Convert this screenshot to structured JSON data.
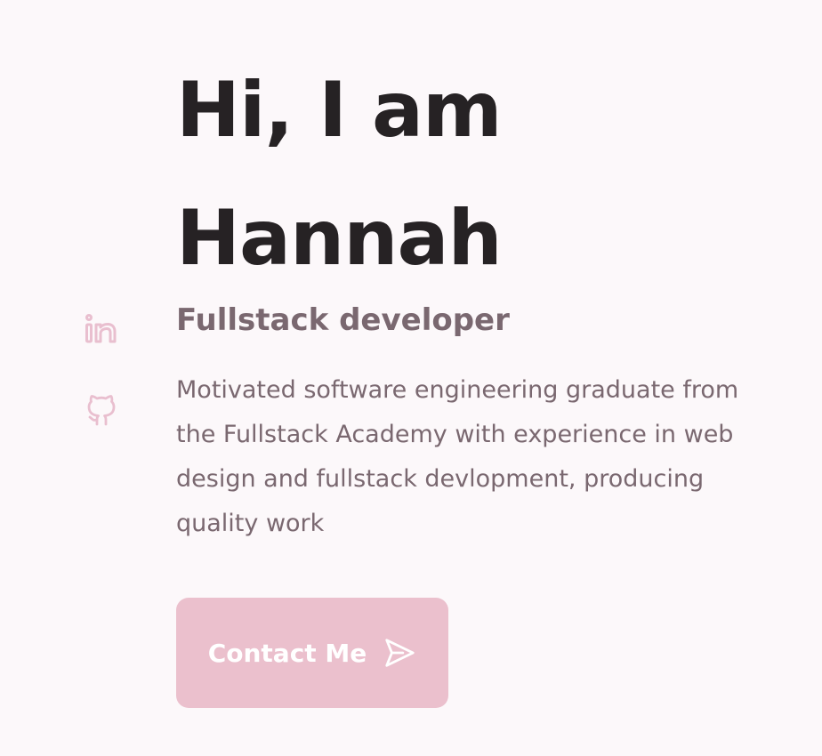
{
  "hero": {
    "title_line1": "Hi, I am",
    "title_line2": "Hannah",
    "subtitle": "Fullstack developer",
    "description": "Motivated software engineering graduate from the Fullstack Academy with experience in web design and fullstack devlopment, producing quality work",
    "contact_label": "Contact Me"
  },
  "social": {
    "items": [
      {
        "icon": "linkedin-icon"
      },
      {
        "icon": "github-icon"
      }
    ]
  },
  "colors": {
    "background": "#fcf8fa",
    "title": "#262224",
    "text": "#7a6870",
    "accent": "#ebc0cd",
    "icon": "#e9bfcf"
  }
}
